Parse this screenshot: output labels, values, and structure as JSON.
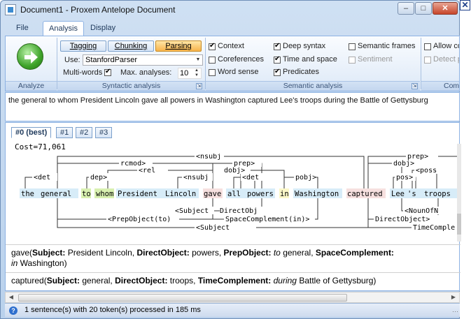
{
  "window": {
    "title": "Document1 - Proxem Antelope Document",
    "min": "–",
    "max": "□",
    "close": "✕",
    "outer_close": "✕"
  },
  "tabs": [
    {
      "label": "File"
    },
    {
      "label": "Analysis",
      "active": true
    },
    {
      "label": "Display"
    }
  ],
  "ribbon": {
    "groups": {
      "analyze": "Analyze",
      "syntactic": "Syntactic analysis",
      "semantic": "Semantic analysis",
      "com": "Com"
    },
    "modes": [
      "Tagging",
      "Chunking",
      "Parsing"
    ],
    "use_label": "Use:",
    "parser": "StanfordParser",
    "multiwords_label": "Multi-words",
    "max_analyses_label": "Max. analyses:",
    "max_analyses_value": "10",
    "semantic_checks": [
      {
        "label": "Context",
        "checked": true
      },
      {
        "label": "Coreferences",
        "checked": false
      },
      {
        "label": "Word sense",
        "checked": false
      },
      {
        "label": "Deep syntax",
        "checked": true
      },
      {
        "label": "Time and space",
        "checked": true
      },
      {
        "label": "Predicates",
        "checked": true
      },
      {
        "label": "Semantic frames",
        "checked": false
      },
      {
        "label": "Sentiment",
        "checked": false,
        "disabled": true
      },
      {
        "label": "Allow cor",
        "checked": false
      },
      {
        "label": "Detect p",
        "checked": false,
        "disabled": true
      }
    ]
  },
  "sentence": "the general to whom President Lincoln gave all powers in Washington captured Lee's troops during the Battle of Gettysburg",
  "analysis": {
    "subtabs": [
      "#0 (best)",
      "#1",
      "#2",
      "#3"
    ],
    "cost": "Cost=71,061",
    "tokens": [
      "the",
      "general",
      "to",
      "whom",
      "President",
      "Lincoln",
      "gave",
      "all",
      "powers",
      "in",
      "Washington",
      "captured",
      "Lee",
      "'s",
      "troops"
    ],
    "arc_labels": {
      "nsubj": "nsubj",
      "rcmod": "rcmod",
      "prep": "prep",
      "prep2": "prep",
      "rel": "rel",
      "dobj": "dobj",
      "dobj2": "dobj",
      "poss": "poss",
      "det": "det",
      "dep": "dep",
      "nsubj2": "nsubj",
      "det2": "det",
      "pobj": "pobj",
      "pos": "pos",
      "subject": "Subject",
      "directobj": "DirectObj",
      "nounofn": "NounOfN",
      "prepobject": "PrepObject(to)",
      "spacecomp": "SpaceComplement(in)",
      "directobject": "DirectObject",
      "subject2": "Subject",
      "timecomp": "TimeComple"
    },
    "semantics": [
      {
        "pred": "gave",
        "text": "gave(Subject: President Lincoln, DirectObject: powers, PrepObject: to general, SpaceComplement: in Washington)"
      },
      {
        "pred": "captured",
        "text": "captured(Subject: general, DirectObject: troops, TimeComplement: during Battle of Gettysburg)"
      }
    ]
  },
  "status": "1 sentence(s) with 20 token(s) processed in 185 ms",
  "colors": {
    "token_blue": "#d7ecf8",
    "token_green": "#d8f0b0",
    "token_pink": "#f6e0df",
    "token_yellow": "#fbf7c8",
    "accent": "#f7b34a"
  }
}
